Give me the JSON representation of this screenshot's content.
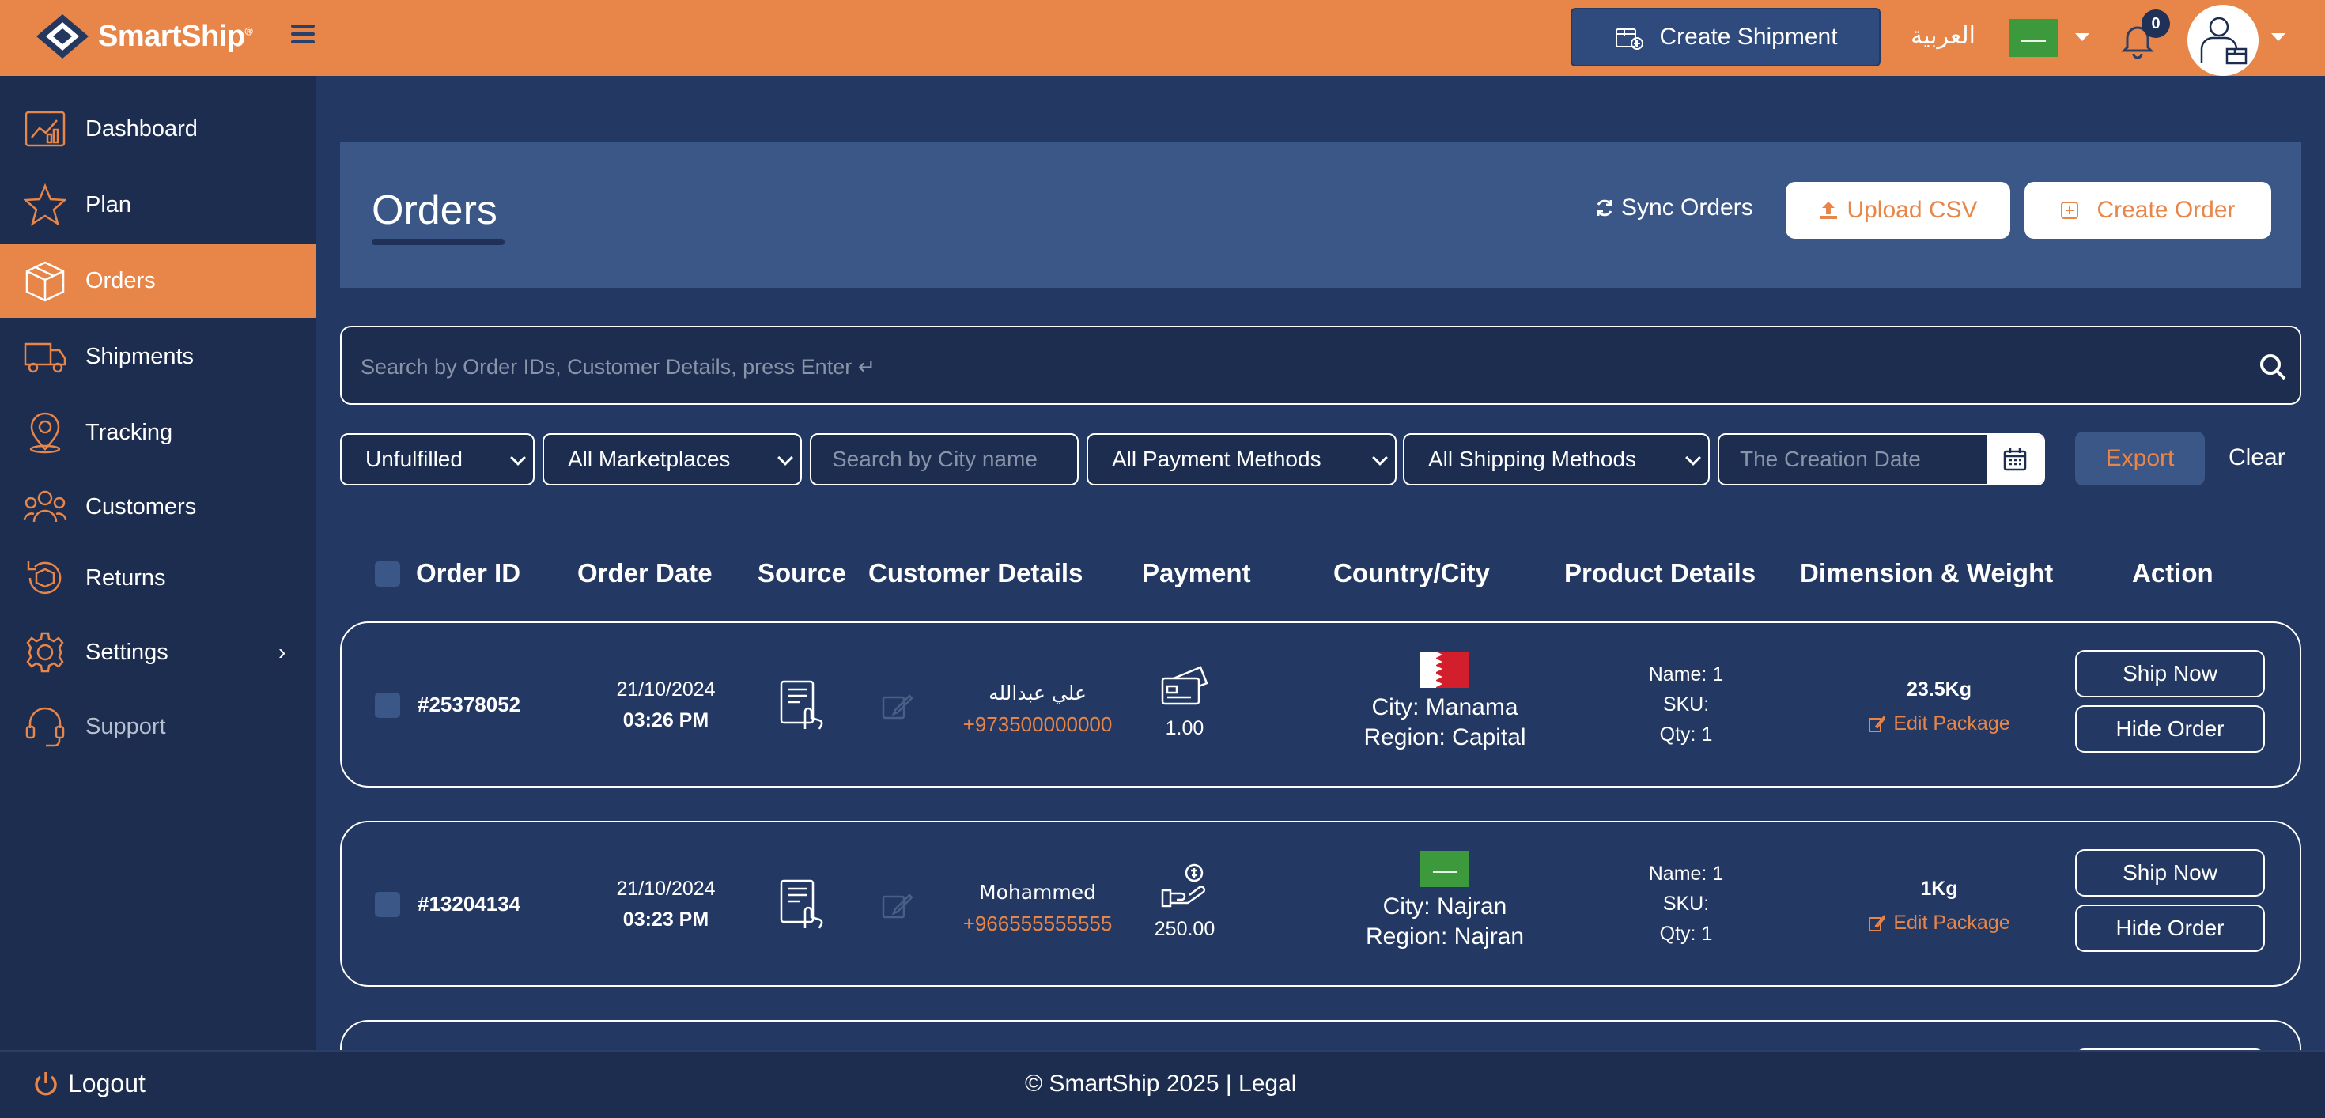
{
  "brand": {
    "name": "SmartShip",
    "trademark": "®"
  },
  "header": {
    "create_shipment_label": "Create Shipment",
    "language_label": "العربية",
    "notification_count": "0"
  },
  "sidebar": {
    "items": [
      {
        "label": "Dashboard",
        "icon": "dashboard-icon"
      },
      {
        "label": "Plan",
        "icon": "star-icon"
      },
      {
        "label": "Orders",
        "icon": "box-icon",
        "active": true
      },
      {
        "label": "Shipments",
        "icon": "truck-icon"
      },
      {
        "label": "Tracking",
        "icon": "tracking-pin-icon"
      },
      {
        "label": "Customers",
        "icon": "users-icon"
      },
      {
        "label": "Returns",
        "icon": "returns-icon"
      },
      {
        "label": "Settings",
        "icon": "gear-icon",
        "arrow": "›"
      },
      {
        "label": "Support",
        "icon": "headset-icon",
        "muted": true
      }
    ],
    "logout_label": "Logout"
  },
  "page": {
    "title": "Orders",
    "sync_label": "Sync Orders",
    "upload_label": "Upload CSV",
    "create_order_label": "Create Order"
  },
  "search": {
    "placeholder": "Search by Order IDs, Customer Details, press Enter ↵"
  },
  "filters": {
    "status": "Unfulfilled",
    "marketplace": "All Marketplaces",
    "city_placeholder": "Search by City name",
    "payment": "All Payment Methods",
    "shipping": "All Shipping Methods",
    "date_placeholder": "The Creation Date",
    "export_label": "Export",
    "clear_label": "Clear"
  },
  "table": {
    "headers": {
      "order_id": "Order ID",
      "order_date": "Order Date",
      "source": "Source",
      "customer": "Customer Details",
      "payment": "Payment",
      "country_city": "Country/City",
      "product": "Product Details",
      "dimension": "Dimension & Weight",
      "action": "Action"
    },
    "rows": [
      {
        "order_id": "#25378052",
        "date": "21/10/2024",
        "time": "03:26 PM",
        "customer_name": "علي عبدالله",
        "customer_phone": "+973500000000",
        "payment_icon": "card-payment-icon",
        "payment_amount": "1.00",
        "flag": "bahrain-flag-icon",
        "city": "City: Manama",
        "region": "Region: Capital",
        "product_name": "Name: 1",
        "product_sku": "SKU:",
        "product_qty": "Qty: 1",
        "weight": "23.5Kg",
        "edit_label": "Edit Package",
        "ship_label": "Ship Now",
        "hide_label": "Hide Order"
      },
      {
        "order_id": "#13204134",
        "date": "21/10/2024",
        "time": "03:23 PM",
        "customer_name": "Mohammed",
        "customer_phone": "+966555555555",
        "payment_icon": "cash-payment-icon",
        "payment_amount": "250.00",
        "flag": "saudi-flag-icon",
        "city": "City: Najran",
        "region": "Region: Najran",
        "product_name": "Name: 1",
        "product_sku": "SKU:",
        "product_qty": "Qty: 1",
        "weight": "1Kg",
        "edit_label": "Edit Package",
        "ship_label": "Ship Now",
        "hide_label": "Hide Order"
      }
    ]
  },
  "footer": {
    "copyright": "© SmartShip 2025 | Legal"
  },
  "colors": {
    "accent": "#e8864a",
    "navy": "#1c2d4f",
    "panel": "#3a5787"
  }
}
